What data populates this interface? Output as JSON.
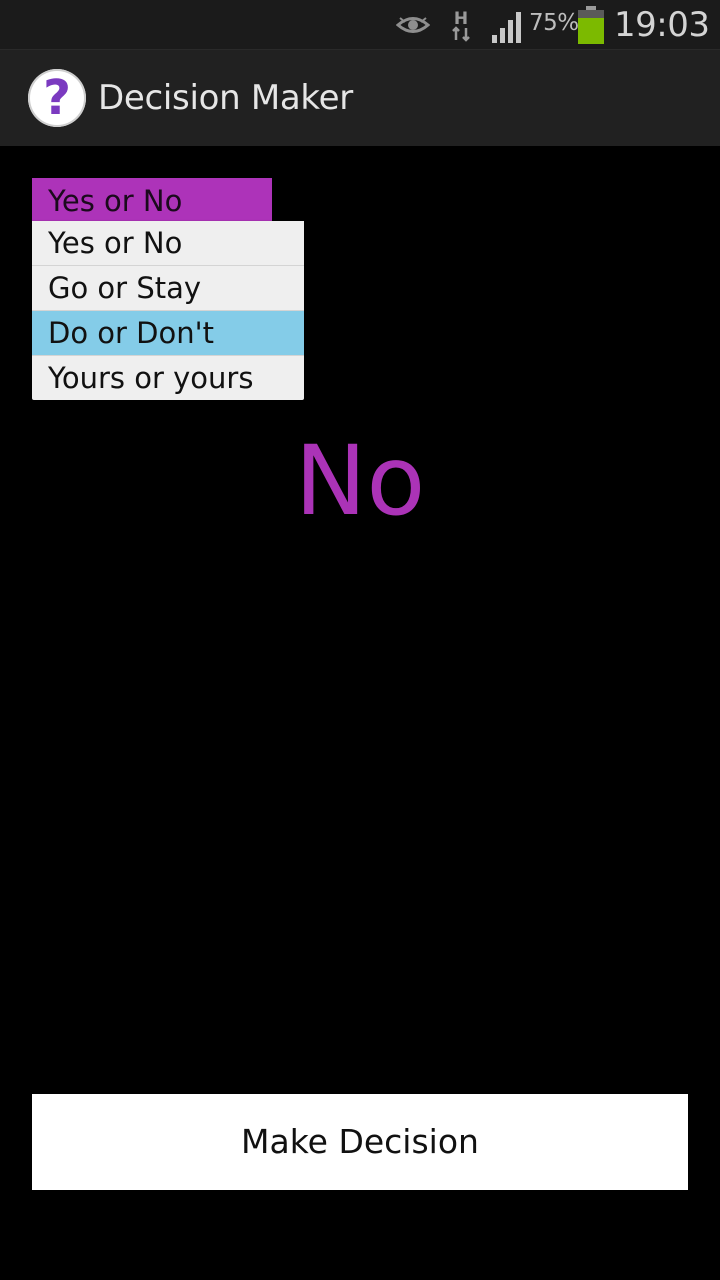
{
  "status_bar": {
    "eye_icon": "eye-icon",
    "network_type": "H",
    "battery_percent": "75%",
    "clock": "19:03",
    "battery_color": "#7cba00"
  },
  "action_bar": {
    "app_icon_glyph": "?",
    "title": "Decision Maker"
  },
  "spinner": {
    "selected": "Yes or No",
    "color": "#ad33b9"
  },
  "dropdown": {
    "options": [
      "Yes or No",
      "Go or Stay",
      "Do or Don't",
      "Yours or yours"
    ],
    "highlighted_index": 2
  },
  "result": {
    "text": "No",
    "color": "#ab33b7"
  },
  "button": {
    "label": "Make Decision"
  }
}
